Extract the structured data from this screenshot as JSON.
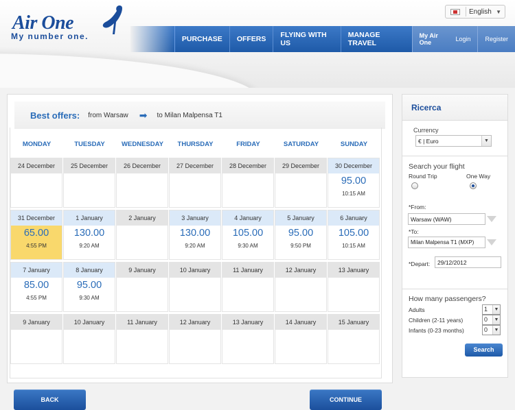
{
  "header": {
    "logo_brand": "Air One",
    "logo_tagline": "My number one.",
    "language": "English",
    "nav": [
      "PURCHASE",
      "OFFERS",
      "FLYING WITH US",
      "MANAGE TRAVEL"
    ],
    "account": {
      "my": "My Air One",
      "login": "Login",
      "register": "Register"
    }
  },
  "offers": {
    "title": "Best offers:",
    "from": "from Warsaw",
    "to": "to Milan Malpensa T1"
  },
  "calendar": {
    "days": [
      "MONDAY",
      "TUESDAY",
      "WEDNESDAY",
      "THURSDAY",
      "FRIDAY",
      "SATURDAY",
      "SUNDAY"
    ],
    "weeks": [
      [
        {
          "date": "24 December",
          "price": "",
          "time": ""
        },
        {
          "date": "25 December",
          "price": "",
          "time": ""
        },
        {
          "date": "26 December",
          "price": "",
          "time": ""
        },
        {
          "date": "27 December",
          "price": "",
          "time": ""
        },
        {
          "date": "28 December",
          "price": "",
          "time": ""
        },
        {
          "date": "29 December",
          "price": "",
          "time": ""
        },
        {
          "date": "30 December",
          "price": "95.00",
          "time": "10:15 AM"
        }
      ],
      [
        {
          "date": "31 December",
          "price": "65.00",
          "time": "4:55 PM",
          "highlight": true
        },
        {
          "date": "1 January",
          "price": "130.00",
          "time": "9:20 AM"
        },
        {
          "date": "2 January",
          "price": "",
          "time": ""
        },
        {
          "date": "3 January",
          "price": "130.00",
          "time": "9:20 AM"
        },
        {
          "date": "4 January",
          "price": "105.00",
          "time": "9:30 AM"
        },
        {
          "date": "5 January",
          "price": "95.00",
          "time": "9:50 PM"
        },
        {
          "date": "6 January",
          "price": "105.00",
          "time": "10:15 AM"
        }
      ],
      [
        {
          "date": "7 January",
          "price": "85.00",
          "time": "4:55 PM"
        },
        {
          "date": "8 January",
          "price": "95.00",
          "time": "9:30 AM"
        },
        {
          "date": "9 January",
          "price": "",
          "time": ""
        },
        {
          "date": "10 January",
          "price": "",
          "time": ""
        },
        {
          "date": "11 January",
          "price": "",
          "time": ""
        },
        {
          "date": "12 January",
          "price": "",
          "time": ""
        },
        {
          "date": "13 January",
          "price": "",
          "time": ""
        }
      ],
      [
        {
          "date": "9 January",
          "price": "",
          "time": ""
        },
        {
          "date": "10 January",
          "price": "",
          "time": ""
        },
        {
          "date": "11 January",
          "price": "",
          "time": ""
        },
        {
          "date": "12 January",
          "price": "",
          "time": ""
        },
        {
          "date": "13 January",
          "price": "",
          "time": ""
        },
        {
          "date": "14 January",
          "price": "",
          "time": ""
        },
        {
          "date": "15 January",
          "price": "",
          "time": ""
        }
      ]
    ]
  },
  "buttons": {
    "back": "BACK",
    "continue": "CONTINUE"
  },
  "sidebar": {
    "title": "Ricerca",
    "currency_label": "Currency",
    "currency_value": "€ | Euro",
    "search_title": "Search your flight",
    "round_trip": "Round Trip",
    "one_way": "One Way",
    "from_label": "*From:",
    "from_value": "Warsaw (WAW)",
    "to_label": "*To:",
    "to_value": "Milan Malpensa T1 (MXP)",
    "depart_label": "*Depart:",
    "depart_value": "29/12/2012",
    "passengers_title": "How many passengers?",
    "adults_label": "Adults",
    "adults_value": "1",
    "children_label": "Children (2-11 years)",
    "children_value": "0",
    "infants_label": "Infants (0-23 months)",
    "infants_value": "0",
    "search_button": "Search"
  },
  "colors": {
    "brand_blue": "#1b4d9b",
    "link_blue": "#2a6cb8",
    "highlight": "#f9d86c"
  }
}
